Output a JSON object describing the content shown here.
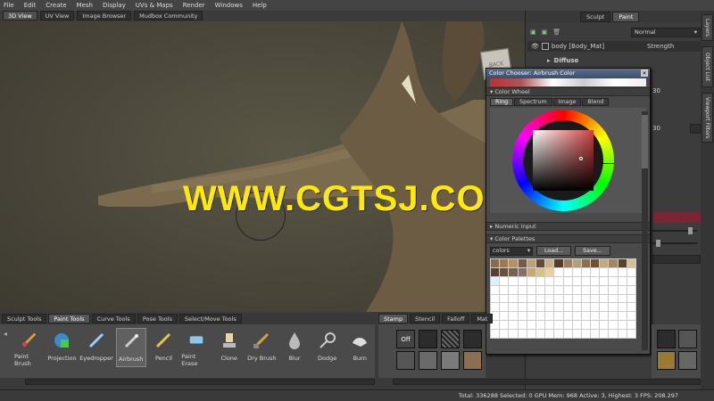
{
  "menu": [
    "File",
    "Edit",
    "Create",
    "Mesh",
    "Display",
    "UVs & Maps",
    "Render",
    "Windows",
    "Help"
  ],
  "view_tabs": [
    "3D View",
    "UV View",
    "Image Browser",
    "Mudbox Community"
  ],
  "viewport": {
    "watermark": "WWW.CGTSJ.COM",
    "cube_label": "BACK"
  },
  "right_panel": {
    "tabs": [
      "Sculpt",
      "Paint"
    ],
    "blend_mode": "Normal",
    "layer_name": "body [Body_Mat]",
    "strength_label": "Strength",
    "diffuse_label": "Diffuse",
    "values": [
      "30",
      "30"
    ]
  },
  "side_tabs": [
    "Layers",
    "Object List",
    "Viewport Filters"
  ],
  "color_chooser": {
    "title": "Color Chooser: Airbrush Color",
    "section_color_wheel": "Color Wheel",
    "wheel_tabs": [
      "Ring",
      "Spectrum",
      "Image",
      "Blend"
    ],
    "section_numeric": "Numeric Input",
    "section_palettes": "Color Palettes",
    "palette_select": "colors",
    "load_button": "Load...",
    "save_button": "Save..."
  },
  "bottom_tabs": [
    "Sculpt Tools",
    "Paint Tools",
    "Curve Tools",
    "Pose Tools",
    "Select/Move Tools"
  ],
  "tools": [
    {
      "label": "Paint Brush",
      "icon": "paint-brush-icon"
    },
    {
      "label": "Projection",
      "icon": "projection-icon"
    },
    {
      "label": "Eyedropper",
      "icon": "eyedropper-icon"
    },
    {
      "label": "Airbrush",
      "icon": "airbrush-icon"
    },
    {
      "label": "Pencil",
      "icon": "pencil-icon"
    },
    {
      "label": "Paint Erase",
      "icon": "eraser-icon"
    },
    {
      "label": "Clone",
      "icon": "clone-icon"
    },
    {
      "label": "Dry Brush",
      "icon": "dry-brush-icon"
    },
    {
      "label": "Blur",
      "icon": "blur-icon"
    },
    {
      "label": "Dodge",
      "icon": "dodge-icon"
    },
    {
      "label": "Burn",
      "icon": "burn-icon"
    }
  ],
  "stamp_tabs": [
    "Stamp",
    "Stencil",
    "Falloff",
    "Mat"
  ],
  "stamp_off_label": "Off",
  "status": "Total: 336288  Selected: 0  GPU Mem: 968  Active: 3, Highest: 3  FPS: 208.297",
  "colors": {
    "accent": "#ffea00",
    "title_bar": "#4a5f80",
    "active_swatch": "#8a2a3a"
  }
}
